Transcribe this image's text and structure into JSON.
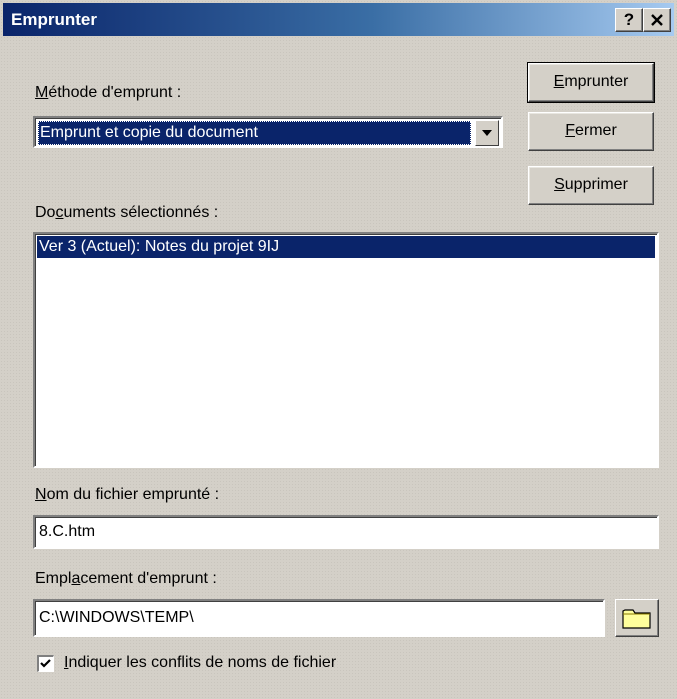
{
  "window": {
    "title": "Emprunter",
    "help_label": "?",
    "close_label": "✕"
  },
  "method": {
    "label_first": "M",
    "label_rest": "éthode d'emprunt :",
    "selected": "Emprunt et copie du document"
  },
  "buttons": {
    "checkout_first": "E",
    "checkout_rest": "mprunter",
    "close_first": "F",
    "close_rest": "ermer",
    "delete_first": "S",
    "delete_rest": "upprimer"
  },
  "documents": {
    "label_a": "Do",
    "label_u": "c",
    "label_b": "uments sélectionnés :",
    "items": [
      "Ver 3 (Actuel): Notes du projet 9IJ"
    ]
  },
  "filename": {
    "label_first": "N",
    "label_rest": "om du fichier emprunté :",
    "value": "8.C.htm"
  },
  "location": {
    "label_a": "Empl",
    "label_u": "a",
    "label_b": "cement d'emprunt :",
    "value": "C:\\WINDOWS\\TEMP\\"
  },
  "conflicts": {
    "label_first": "I",
    "label_rest": "ndiquer les conflits de noms de fichier",
    "checked": true
  },
  "icons": {
    "browse": "folder-icon",
    "checkmark": "checkmark-icon",
    "dropdown": "chevron-down-icon"
  }
}
